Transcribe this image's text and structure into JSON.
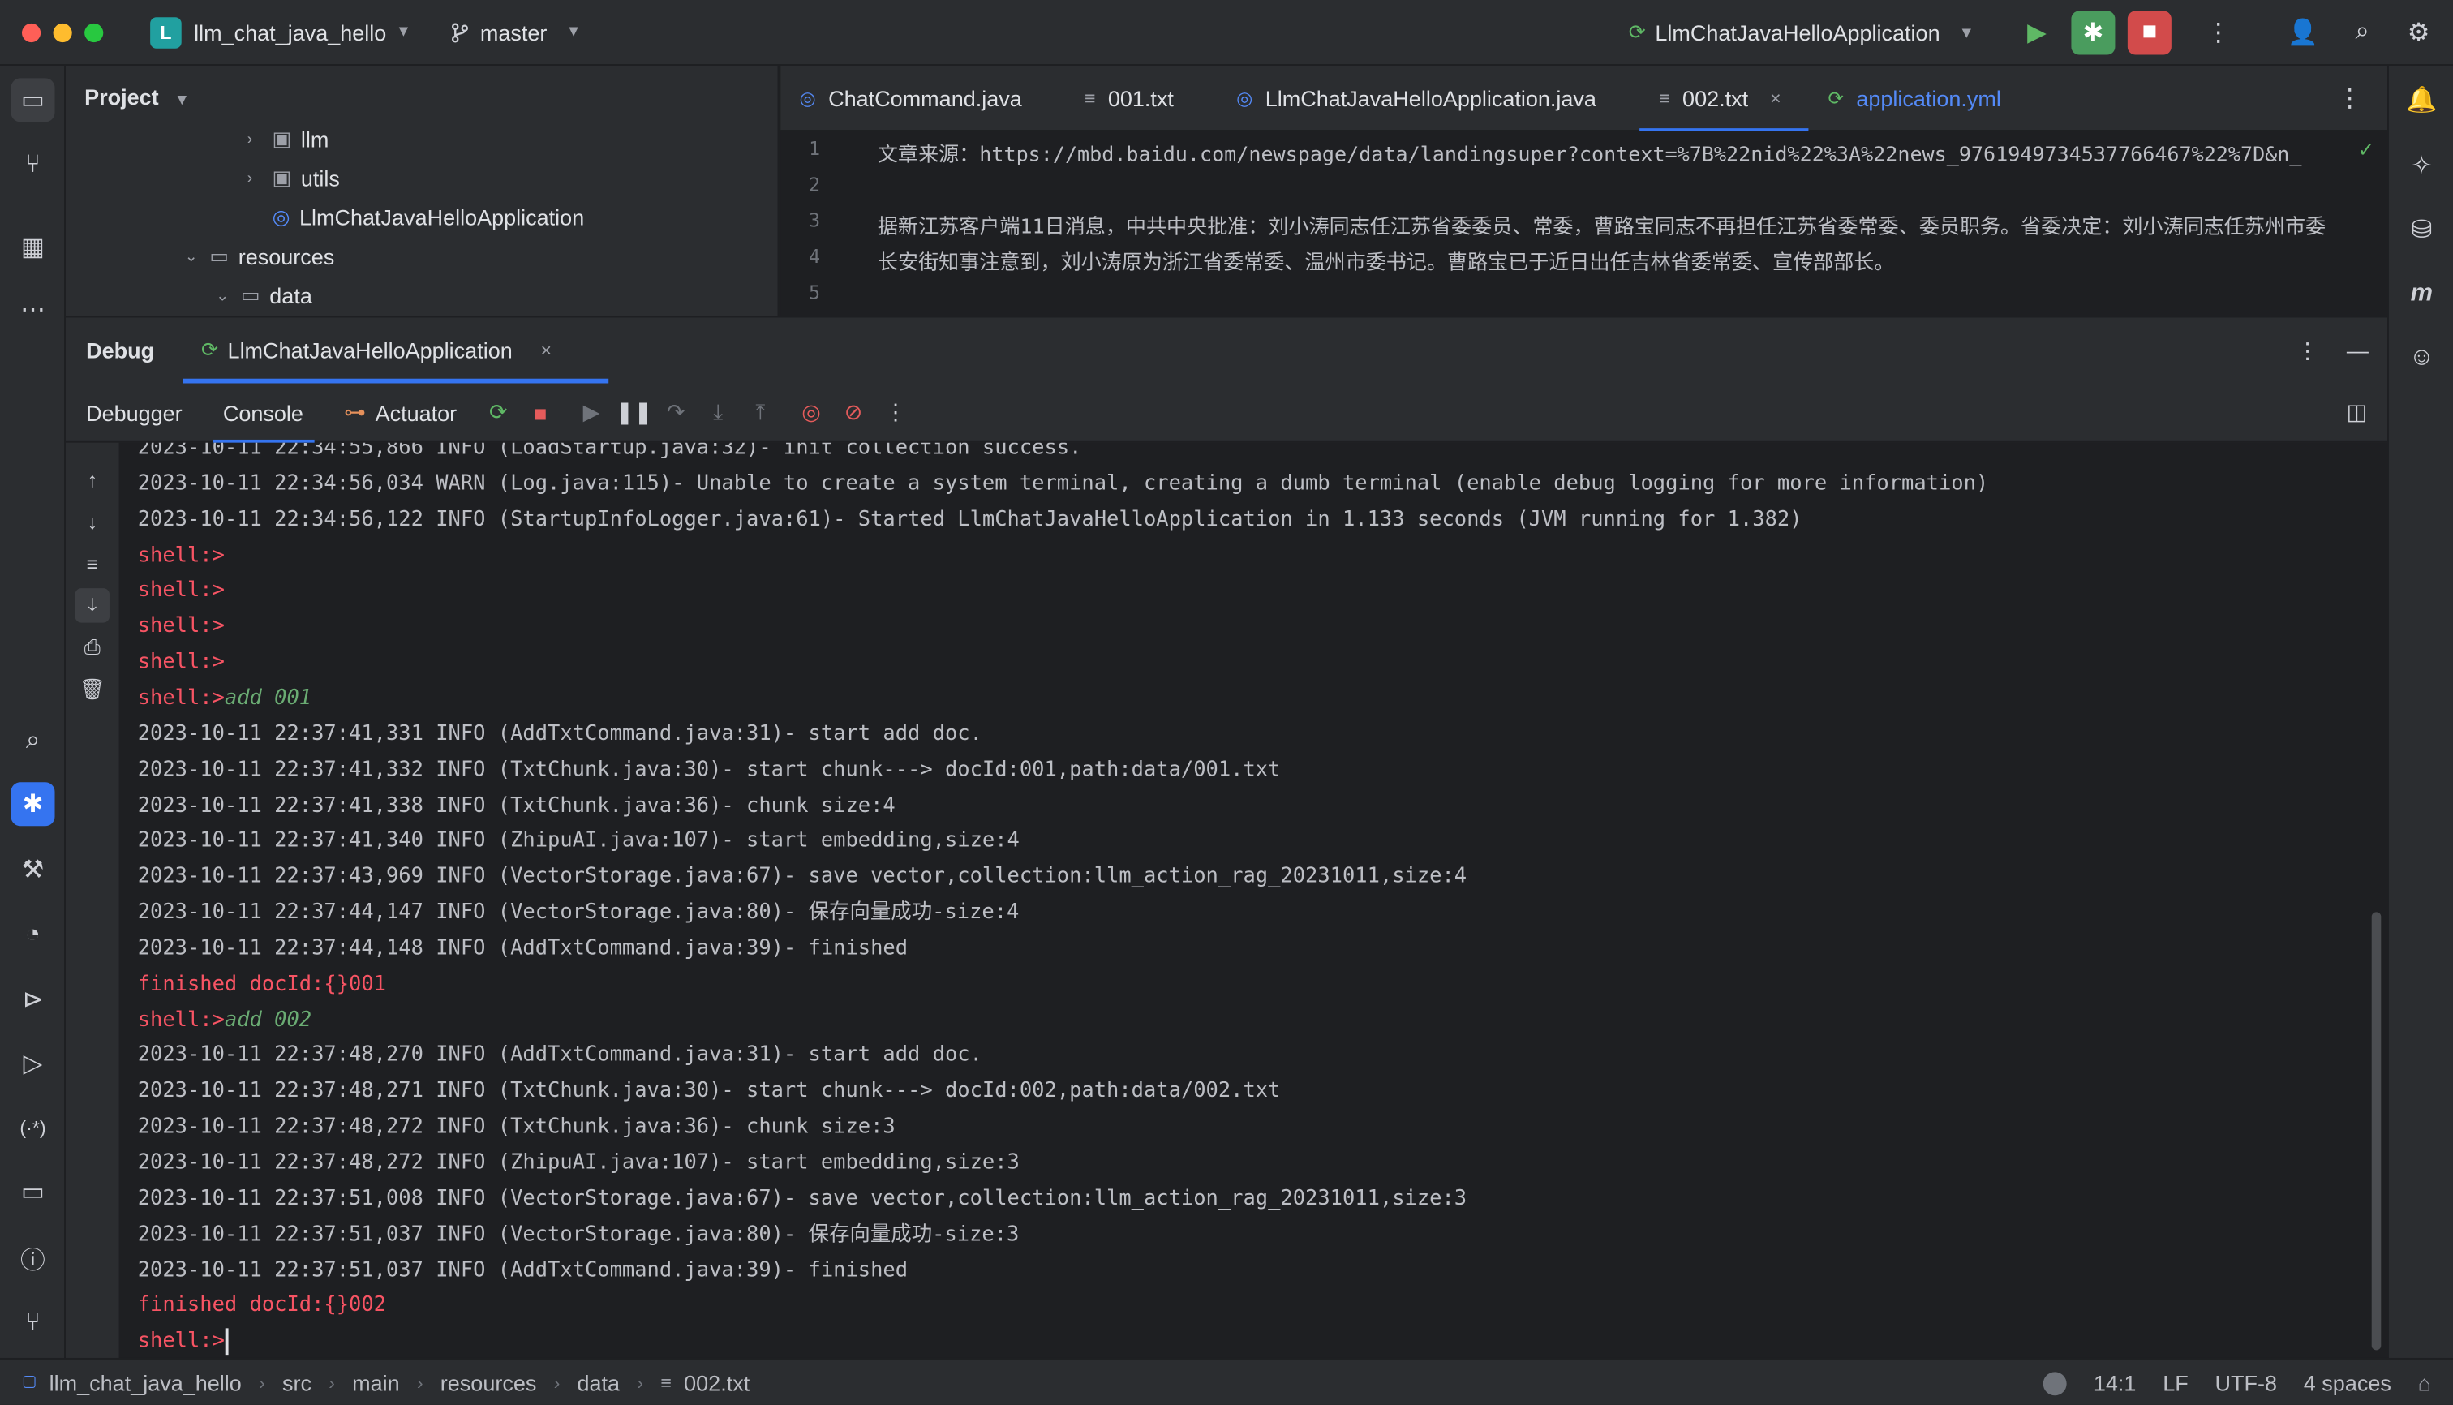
{
  "titlebar": {
    "project_badge": "L",
    "project_name": "llm_chat_java_hello",
    "branch": "master",
    "run_config": "LlmChatJavaHelloApplication",
    "colors": {
      "red": "#ff5f57",
      "yellow": "#febc2e",
      "green": "#28c840",
      "accent": "#3574f0"
    }
  },
  "project_panel": {
    "title": "Project",
    "tree": [
      {
        "label": "llm",
        "indent": 1,
        "kind": "package",
        "expanded": false
      },
      {
        "label": "utils",
        "indent": 1,
        "kind": "package",
        "expanded": false
      },
      {
        "label": "LlmChatJavaHelloApplication",
        "indent": 2,
        "kind": "class"
      },
      {
        "label": "resources",
        "indent": 0,
        "kind": "folder",
        "expanded": true
      },
      {
        "label": "data",
        "indent": 0,
        "kind": "folder",
        "expanded": true
      }
    ]
  },
  "editor": {
    "tabs": [
      {
        "label": "ChatCommand.java",
        "icon": "class-icon"
      },
      {
        "label": "001.txt",
        "icon": "text-file-icon"
      },
      {
        "label": "LlmChatJavaHelloApplication.java",
        "icon": "spring-class-icon"
      },
      {
        "label": "002.txt",
        "icon": "text-file-icon",
        "active": true,
        "close": "×"
      },
      {
        "label": "application.yml",
        "icon": "yaml-icon"
      }
    ],
    "line_numbers": [
      "1",
      "2",
      "3",
      "4",
      "5"
    ],
    "lines": [
      "文章来源：https://mbd.baidu.com/newspage/data/landingsuper?context=%7B%22nid%22%3A%22news_9761949734537766467%22%7D&n_",
      "",
      "据新江苏客户端11日消息，中共中央批准：刘小涛同志任江苏省委委员、常委，曹路宝同志不再担任江苏省委常委、委员职务。省委决定：刘小涛同志任苏州市委",
      "长安街知事注意到，刘小涛原为浙江省委常委、温州市委书记。曹路宝已于近日出任吉林省委常委、宣传部部长。",
      ""
    ]
  },
  "debug": {
    "title": "Debug",
    "session_tab": "LlmChatJavaHelloApplication",
    "session_close": "×",
    "toolbar_tabs": [
      "Debugger",
      "Console",
      "Actuator"
    ],
    "console_lines": [
      {
        "text": "2023-10-11 22:34:55,866 INFO (LoadStartup.java:32)- init collection success.",
        "type": "log"
      },
      {
        "text": "2023-10-11 22:34:56,034 WARN (Log.java:115)- Unable to create a system terminal, creating a dumb terminal (enable debug logging for more information)",
        "type": "log"
      },
      {
        "text": "2023-10-11 22:34:56,122 INFO (StartupInfoLogger.java:61)- Started LlmChatJavaHelloApplication in 1.133 seconds (JVM running for 1.382)",
        "type": "log"
      },
      {
        "text": "shell:>",
        "type": "shell",
        "cmd": ""
      },
      {
        "text": "shell:>",
        "type": "shell",
        "cmd": ""
      },
      {
        "text": "shell:>",
        "type": "shell",
        "cmd": ""
      },
      {
        "text": "shell:>",
        "type": "shell",
        "cmd": ""
      },
      {
        "text": "shell:>",
        "type": "shell",
        "cmd": "add 001"
      },
      {
        "text": "2023-10-11 22:37:41,331 INFO (AddTxtCommand.java:31)- start add doc.",
        "type": "log"
      },
      {
        "text": "2023-10-11 22:37:41,332 INFO (TxtChunk.java:30)- start chunk---> docId:001,path:data/001.txt",
        "type": "log"
      },
      {
        "text": "2023-10-11 22:37:41,338 INFO (TxtChunk.java:36)- chunk size:4",
        "type": "log"
      },
      {
        "text": "2023-10-11 22:37:41,340 INFO (ZhipuAI.java:107)- start embedding,size:4",
        "type": "log"
      },
      {
        "text": "2023-10-11 22:37:43,969 INFO (VectorStorage.java:67)- save vector,collection:llm_action_rag_20231011,size:4",
        "type": "log"
      },
      {
        "text": "2023-10-11 22:37:44,147 INFO (VectorStorage.java:80)- 保存向量成功-size:4",
        "type": "log"
      },
      {
        "text": "2023-10-11 22:37:44,148 INFO (AddTxtCommand.java:39)- finished",
        "type": "log"
      },
      {
        "text": "finished docId:{}001",
        "type": "shell",
        "cmd": ""
      },
      {
        "text": "shell:>",
        "type": "shell",
        "cmd": "add 002"
      },
      {
        "text": "2023-10-11 22:37:48,270 INFO (AddTxtCommand.java:31)- start add doc.",
        "type": "log"
      },
      {
        "text": "2023-10-11 22:37:48,271 INFO (TxtChunk.java:30)- start chunk---> docId:002,path:data/002.txt",
        "type": "log"
      },
      {
        "text": "2023-10-11 22:37:48,272 INFO (TxtChunk.java:36)- chunk size:3",
        "type": "log"
      },
      {
        "text": "2023-10-11 22:37:48,272 INFO (ZhipuAI.java:107)- start embedding,size:3",
        "type": "log"
      },
      {
        "text": "2023-10-11 22:37:51,008 INFO (VectorStorage.java:67)- save vector,collection:llm_action_rag_20231011,size:3",
        "type": "log"
      },
      {
        "text": "2023-10-11 22:37:51,037 INFO (VectorStorage.java:80)- 保存向量成功-size:3",
        "type": "log"
      },
      {
        "text": "2023-10-11 22:37:51,037 INFO (AddTxtCommand.java:39)- finished",
        "type": "log"
      },
      {
        "text": "finished docId:{}002",
        "type": "shell",
        "cmd": ""
      },
      {
        "text": "shell:>",
        "type": "shell",
        "cmd": "",
        "caret": true
      }
    ]
  },
  "statusbar": {
    "breadcrumb": [
      "llm_chat_java_hello",
      "src",
      "main",
      "resources",
      "data",
      "002.txt"
    ],
    "position": "14:1",
    "line_ending": "LF",
    "encoding": "UTF-8",
    "indent": "4 spaces"
  }
}
